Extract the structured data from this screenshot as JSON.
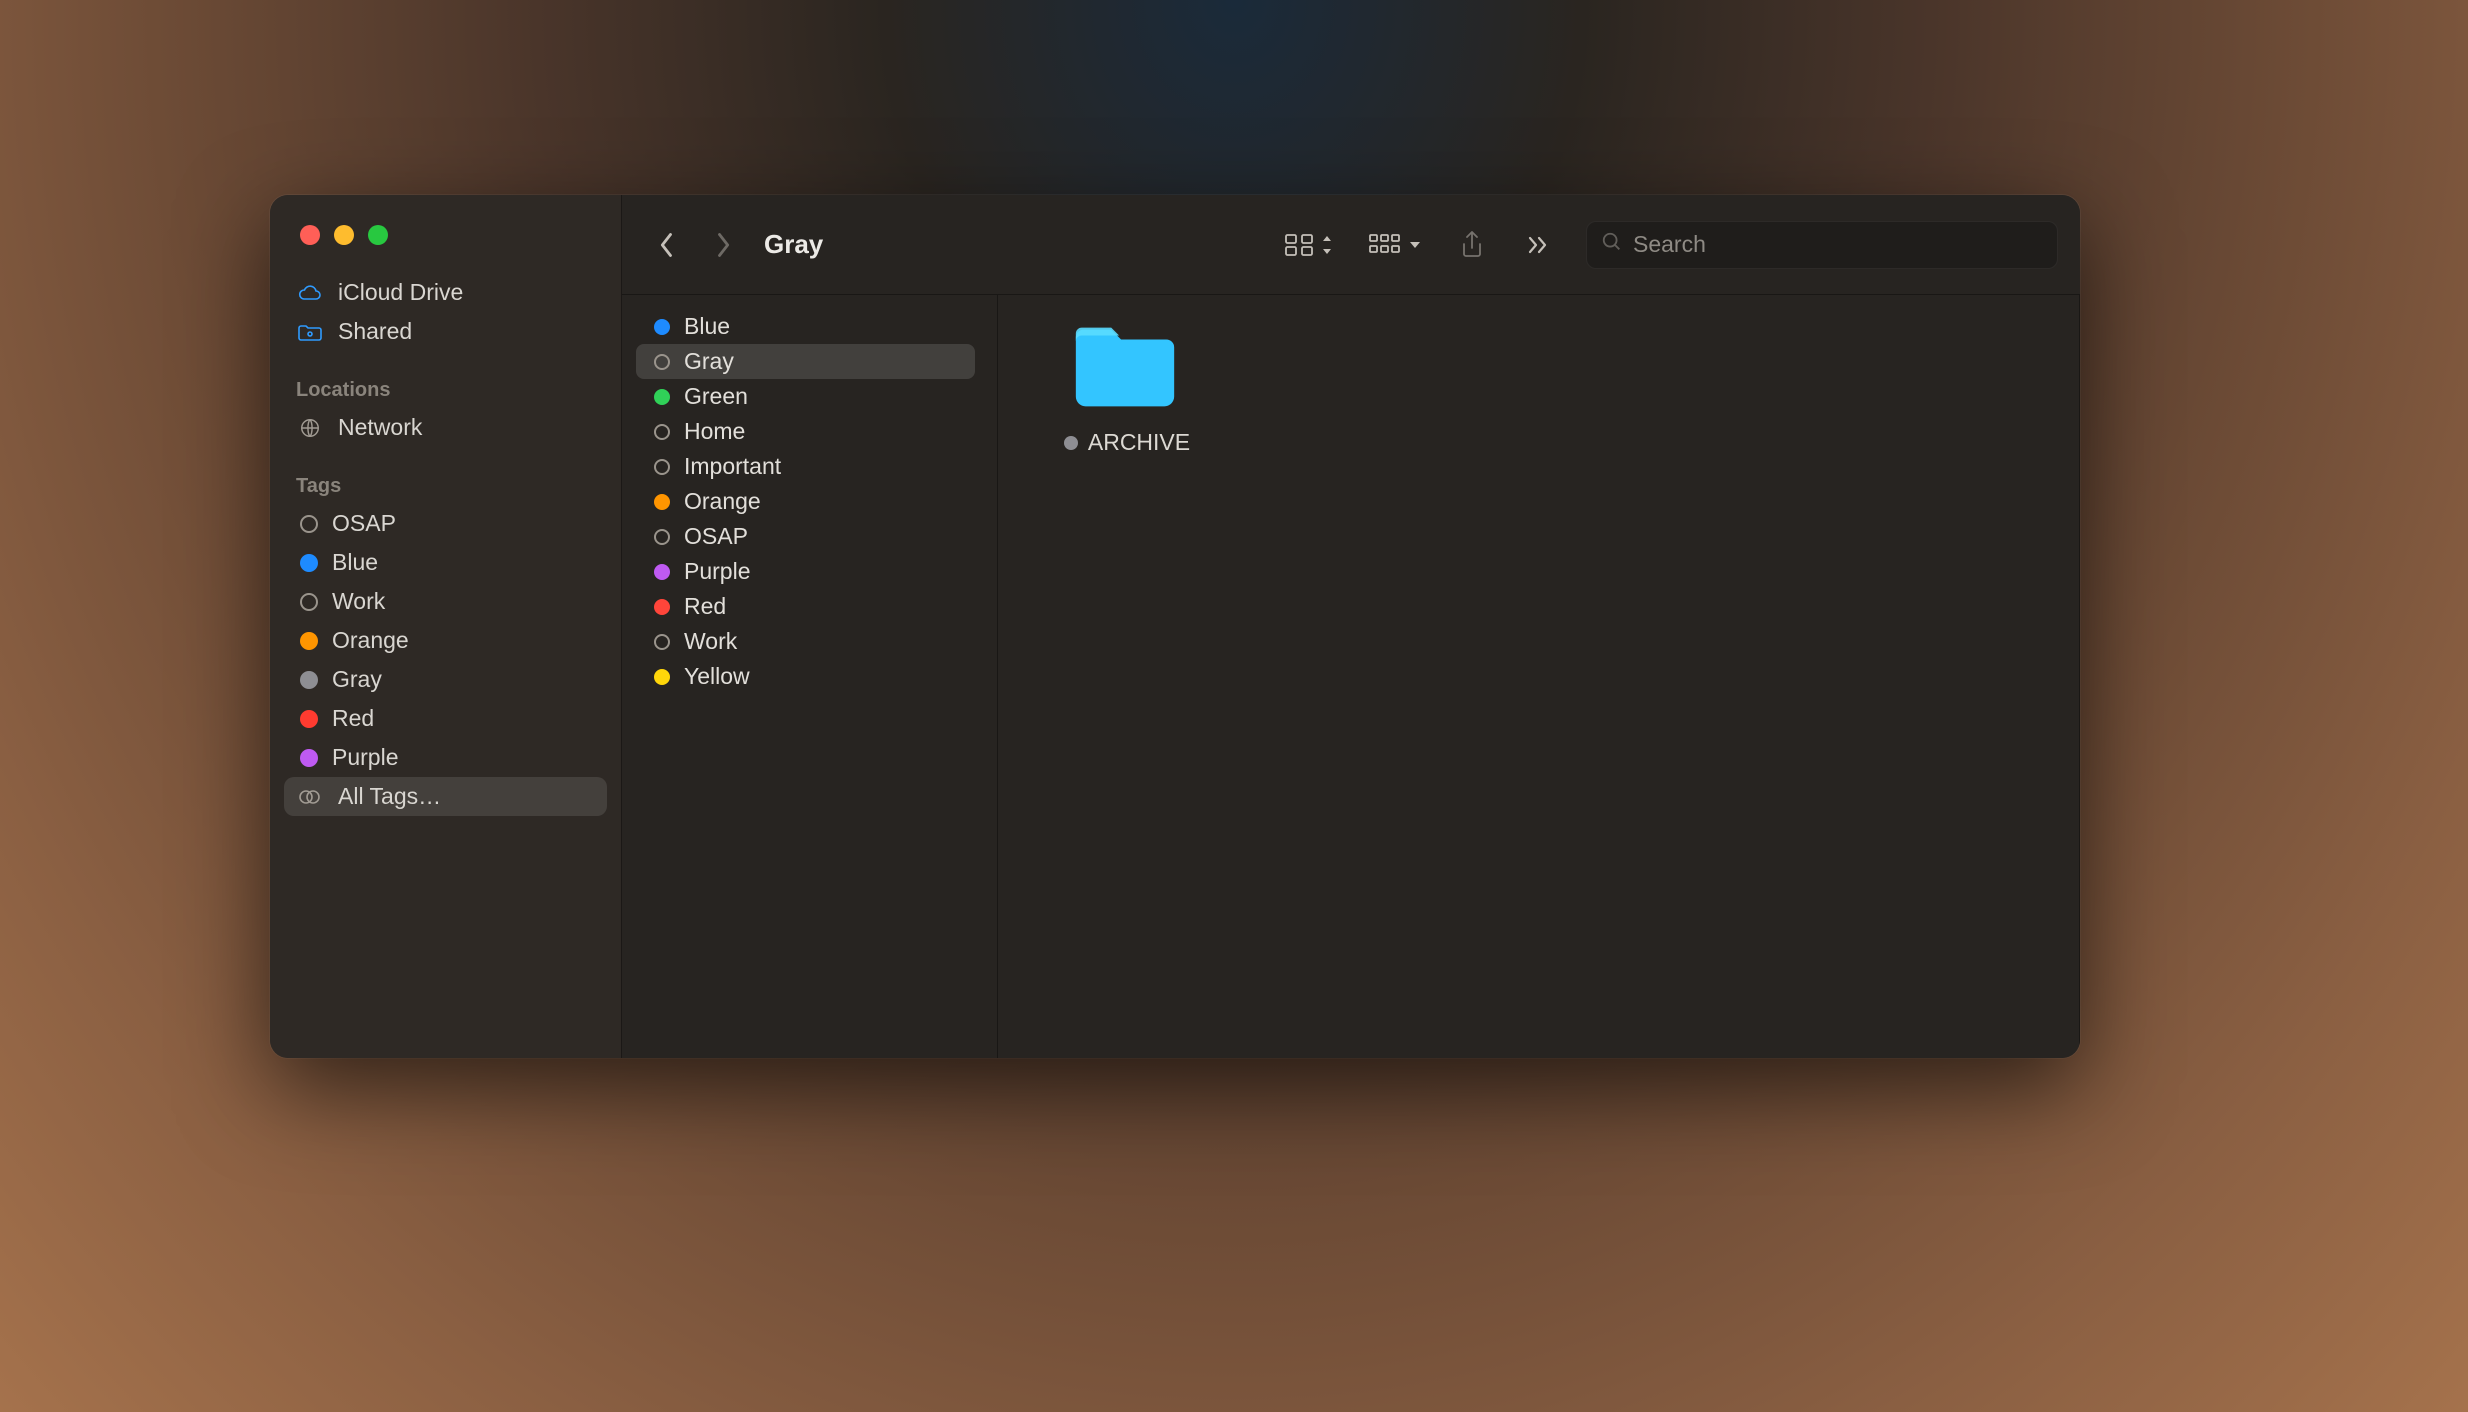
{
  "window": {
    "title": "Gray"
  },
  "toolbar": {
    "search_placeholder": "Search"
  },
  "sidebar": {
    "favorites": [
      {
        "label": "iCloud Drive",
        "icon": "cloud"
      },
      {
        "label": "Shared",
        "icon": "shared-folder"
      }
    ],
    "locations_header": "Locations",
    "locations": [
      {
        "label": "Network",
        "icon": "globe"
      }
    ],
    "tags_header": "Tags",
    "tags": [
      {
        "label": "OSAP",
        "color": "outline"
      },
      {
        "label": "Blue",
        "color": "#1e8bff"
      },
      {
        "label": "Work",
        "color": "outline"
      },
      {
        "label": "Orange",
        "color": "#ff9500"
      },
      {
        "label": "Gray",
        "color": "#8e8e93"
      },
      {
        "label": "Red",
        "color": "#ff3b30"
      },
      {
        "label": "Purple",
        "color": "#bf5af2"
      }
    ],
    "all_tags_label": "All Tags…",
    "all_tags_selected": true
  },
  "column1": {
    "items": [
      {
        "label": "Blue",
        "color": "#1e8bff",
        "selected": false
      },
      {
        "label": "Gray",
        "color": "outline",
        "selected": true
      },
      {
        "label": "Green",
        "color": "#30d158",
        "selected": false
      },
      {
        "label": "Home",
        "color": "outline",
        "selected": false
      },
      {
        "label": "Important",
        "color": "outline",
        "selected": false
      },
      {
        "label": "Orange",
        "color": "#ff9500",
        "selected": false
      },
      {
        "label": "OSAP",
        "color": "outline",
        "selected": false
      },
      {
        "label": "Purple",
        "color": "#bf5af2",
        "selected": false
      },
      {
        "label": "Red",
        "color": "#ff453a",
        "selected": false
      },
      {
        "label": "Work",
        "color": "outline",
        "selected": false
      },
      {
        "label": "Yellow",
        "color": "#ffd60a",
        "selected": false
      }
    ]
  },
  "column2": {
    "items": [
      {
        "label": "ARCHIVE",
        "tag_color": "#8e8e93",
        "folder_color": "#33c5ff"
      }
    ]
  }
}
